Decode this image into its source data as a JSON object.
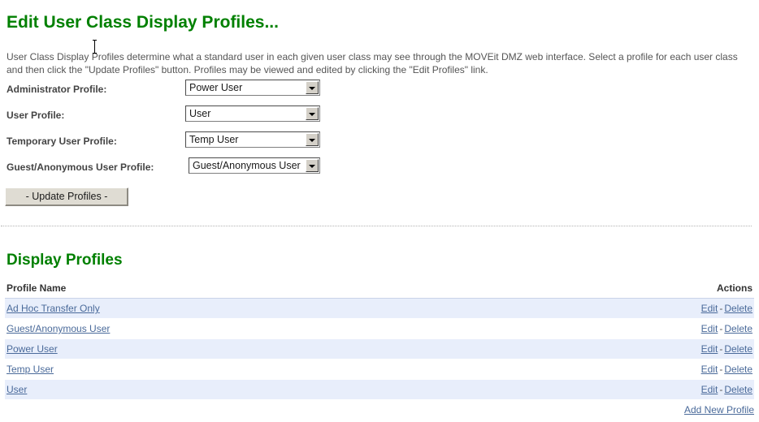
{
  "page": {
    "title": "Edit User Class Display Profiles...",
    "intro": "User Class Display Profiles determine what a standard user in each given user class may see through the MOVEit DMZ web interface. Select a profile for each user class and then click the \"Update Profiles\" button. Profiles may be viewed and edited by clicking the \"Edit Profiles\" link.",
    "accent_color": "#008000",
    "link_color": "#4a6a9a",
    "row_highlight_color": "#e8eefb"
  },
  "form": {
    "rows": [
      {
        "label": "Administrator Profile:",
        "value": "Power User"
      },
      {
        "label": "User Profile:",
        "value": "User"
      },
      {
        "label": "Temporary User Profile:",
        "value": "Temp User"
      },
      {
        "label": "Guest/Anonymous User Profile:",
        "value": "Guest/Anonymous User"
      }
    ],
    "options": [
      "Ad Hoc Transfer Only",
      "Guest/Anonymous User",
      "Power User",
      "Temp User",
      "User"
    ],
    "submit_label": "- Update Profiles -"
  },
  "profiles_section": {
    "heading": "Display Profiles",
    "columns": {
      "name": "Profile Name",
      "actions": "Actions"
    },
    "action_labels": {
      "edit": "Edit",
      "separator": "-",
      "delete": "Delete"
    },
    "rows": [
      {
        "name": "Ad Hoc Transfer Only"
      },
      {
        "name": "Guest/Anonymous User"
      },
      {
        "name": "Power User"
      },
      {
        "name": "Temp User"
      },
      {
        "name": "User"
      }
    ],
    "add_new_label": "Add New Profile"
  },
  "cursor": {
    "type": "text-ibeam"
  }
}
